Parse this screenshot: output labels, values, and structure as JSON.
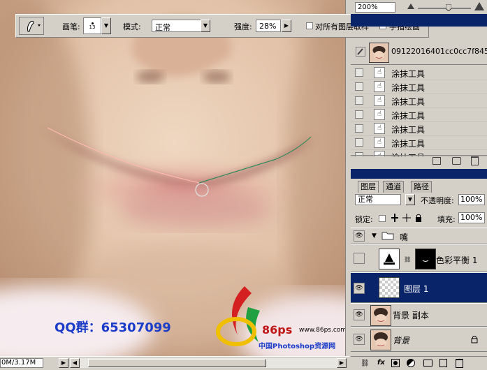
{
  "zoom": "200%",
  "options": {
    "brush_label": "画笔:",
    "brush_size": "13",
    "mode_label": "模式:",
    "mode_value": "正常",
    "strength_label": "强度:",
    "strength_value": "28%",
    "sample_all_label": "对所有图层取样",
    "finger_paint_label": "手指绘画"
  },
  "history": {
    "snapshot_name": "09122016401cc0cc7f845...",
    "items": [
      {
        "label": "涂抹工具"
      },
      {
        "label": "涂抹工具"
      },
      {
        "label": "涂抹工具"
      },
      {
        "label": "涂抹工具"
      },
      {
        "label": "涂抹工具"
      },
      {
        "label": "涂抹工具"
      },
      {
        "label": "涂抹工具"
      }
    ]
  },
  "layers": {
    "tabs": [
      "图层",
      "通道",
      "路径"
    ],
    "blend_mode": "正常",
    "opacity_label": "不透明度:",
    "opacity_value": "100%",
    "lock_label": "锁定:",
    "fill_label": "填充:",
    "fill_value": "100%",
    "items": [
      {
        "name": "嘴"
      },
      {
        "name": "色彩平衡 1"
      },
      {
        "name": "图层 1"
      },
      {
        "name": "背景 副本"
      },
      {
        "name": "背景"
      }
    ]
  },
  "watermark": {
    "qq": "QQ群：65307099",
    "brand": "86ps",
    "url": "www.86ps.com",
    "site": "中国Photoshop资源网"
  },
  "status": {
    "doc_size": "0M/3.17M"
  },
  "colors": {
    "selection_blue": "#0a246a",
    "watermark_blue": "#1a3cc8"
  }
}
